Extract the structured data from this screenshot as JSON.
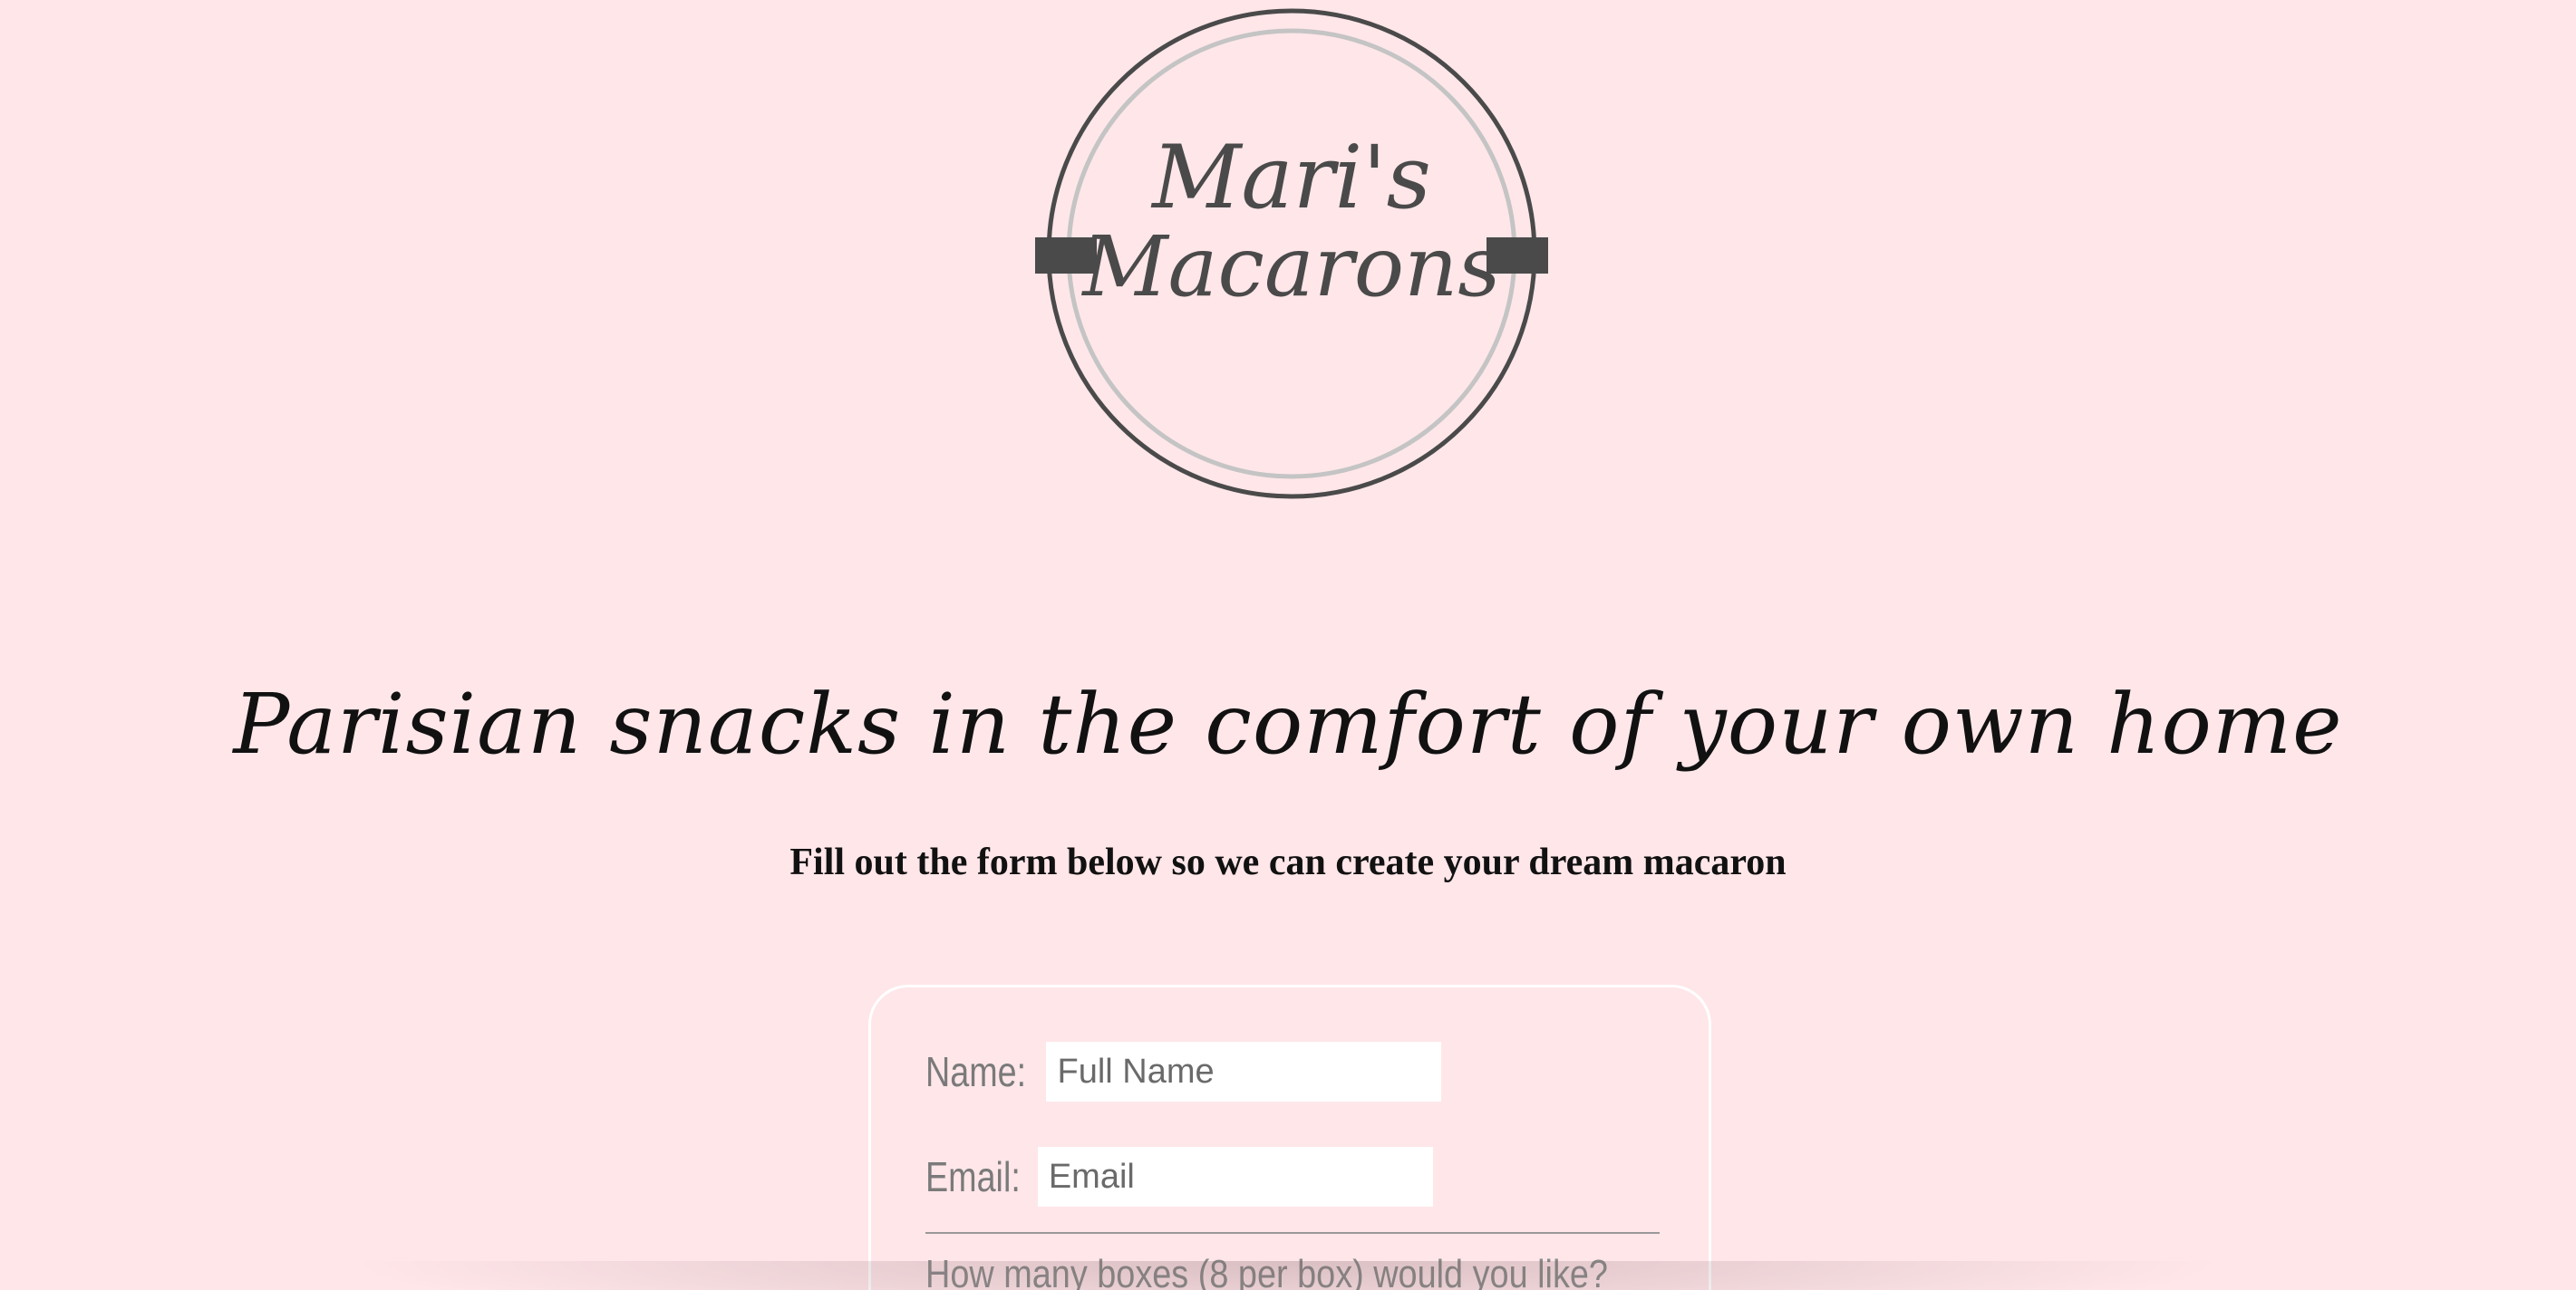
{
  "logo": {
    "line1": "Mari's",
    "line2": "Macarons"
  },
  "hero": {
    "headline": "Parisian snacks in the comfort of your own home",
    "subheading": "Fill out the form below so we can create your dream macaron"
  },
  "form": {
    "name_label": "Name:",
    "name_placeholder": "Full Name",
    "email_label": "Email:",
    "email_placeholder": "Email",
    "boxes_question": "How many boxes (8 per box) would you like?"
  },
  "colors": {
    "background": "#ffe6e9",
    "logo_dark": "#4a4a4a",
    "logo_ring_light": "#c4c4c4"
  }
}
